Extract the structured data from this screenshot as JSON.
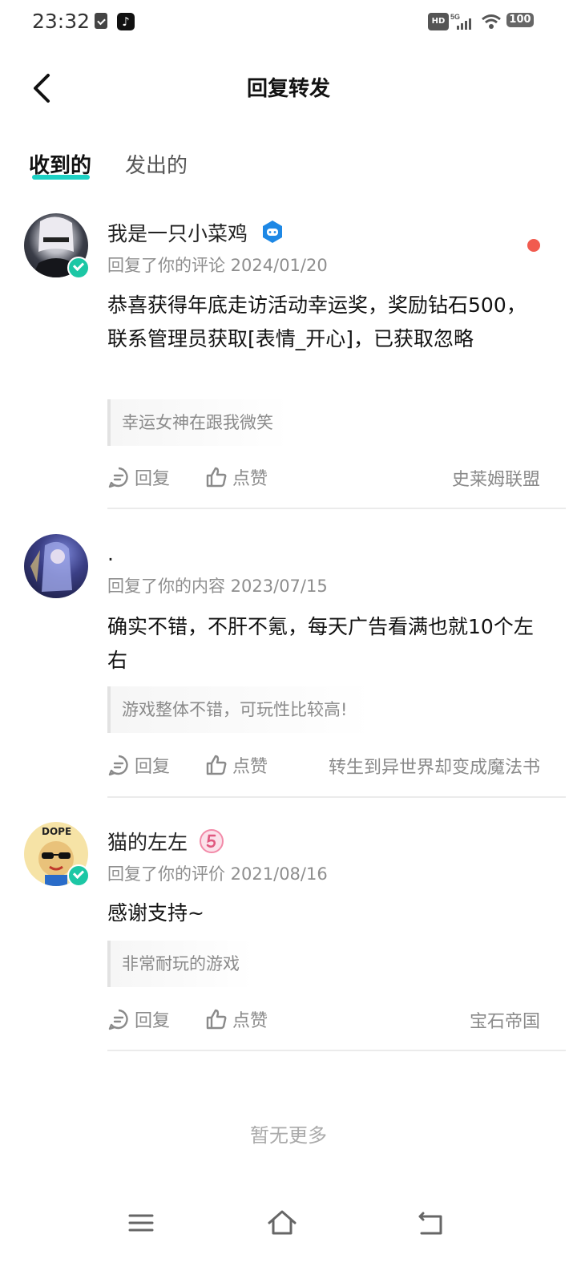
{
  "status_bar": {
    "time": "23:32",
    "tiktok_glyph": "♪",
    "hd": "HD",
    "network": "5G",
    "battery": "100"
  },
  "header": {
    "title": "回复转发"
  },
  "tabs": [
    {
      "label": "收到的",
      "active": true
    },
    {
      "label": "发出的",
      "active": false
    }
  ],
  "items": [
    {
      "username": "我是一只小菜鸡",
      "meta": "回复了你的评论 2024/01/20",
      "content": "恭喜获得年底走访活动幸运奖，奖励钻石500，联系管理员获取[表情_开心]，已获取忽略",
      "quote": "幸运女神在跟我微笑",
      "reply_label": "回复",
      "like_label": "点赞",
      "source": "史莱姆联盟",
      "unread": true
    },
    {
      "username": ".",
      "meta": "回复了你的内容 2023/07/15",
      "content": "确实不错，不肝不氪，每天广告看满也就10个左右",
      "quote": "游戏整体不错，可玩性比较高!",
      "reply_label": "回复",
      "like_label": "点赞",
      "source": "转生到异世界却变成魔法书",
      "unread": false
    },
    {
      "username": "猫的左左",
      "meta": "回复了你的评价 2021/08/16",
      "content": "感谢支持~",
      "quote": "非常耐玩的游戏",
      "reply_label": "回复",
      "like_label": "点赞",
      "source": "宝石帝国",
      "unread": false
    }
  ],
  "footer": {
    "no_more": "暂无更多"
  },
  "colors": {
    "accent": "#1dd1c4",
    "verified": "#1cc7a5",
    "unread": "#f15b4f"
  }
}
